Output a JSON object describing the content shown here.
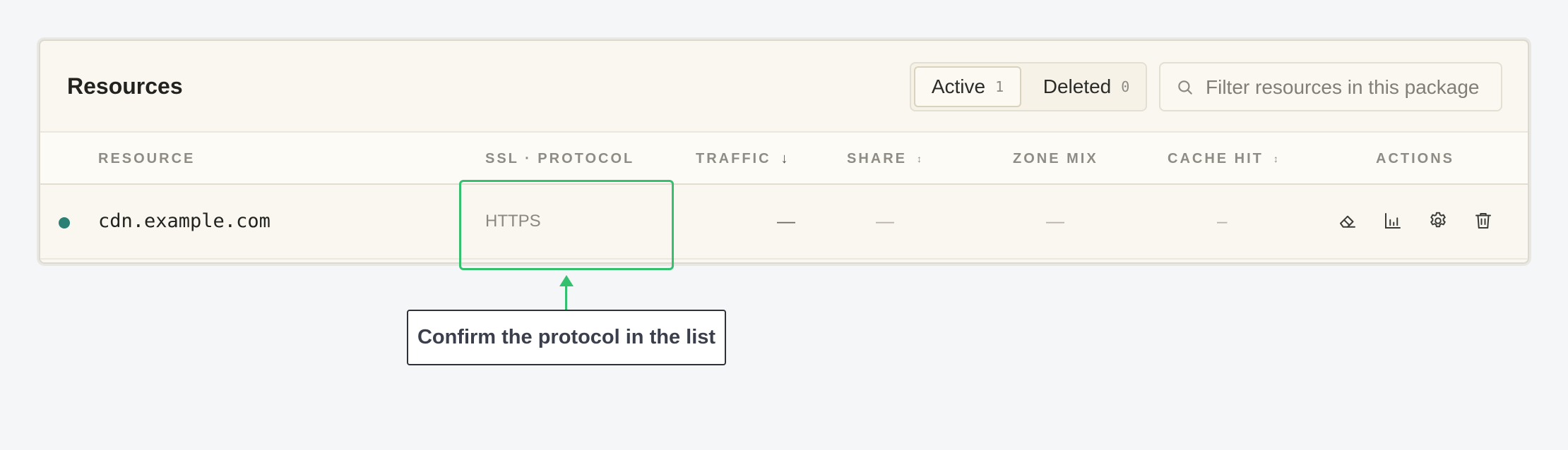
{
  "resources": {
    "title": "Resources",
    "tabs": [
      {
        "label": "Active",
        "count": "1"
      },
      {
        "label": "Deleted",
        "count": "0"
      }
    ],
    "search": {
      "placeholder": "Filter resources in this package",
      "value": ""
    },
    "columns": {
      "resource": "RESOURCE",
      "ssl_protocol": "SSL · PROTOCOL",
      "traffic": "TRAFFIC",
      "traffic_sort": "↓",
      "share": "SHARE",
      "share_sort": "↕",
      "zone_mix": "ZONE MIX",
      "cache_hit": "CACHE HIT",
      "cache_hit_sort": "↕",
      "actions": "ACTIONS"
    },
    "rows": [
      {
        "name": "cdn.example.com",
        "status_color": "#2a8075",
        "protocol": "HTTPS",
        "traffic": "—",
        "share": "—",
        "zone_mix": "—",
        "cache_hit": "–",
        "actions": [
          "eraser-icon",
          "bar-chart-icon",
          "gear-icon",
          "trash-icon"
        ]
      }
    ]
  },
  "annotation": {
    "text": "Confirm the protocol in the list",
    "color": "#34c06f"
  }
}
